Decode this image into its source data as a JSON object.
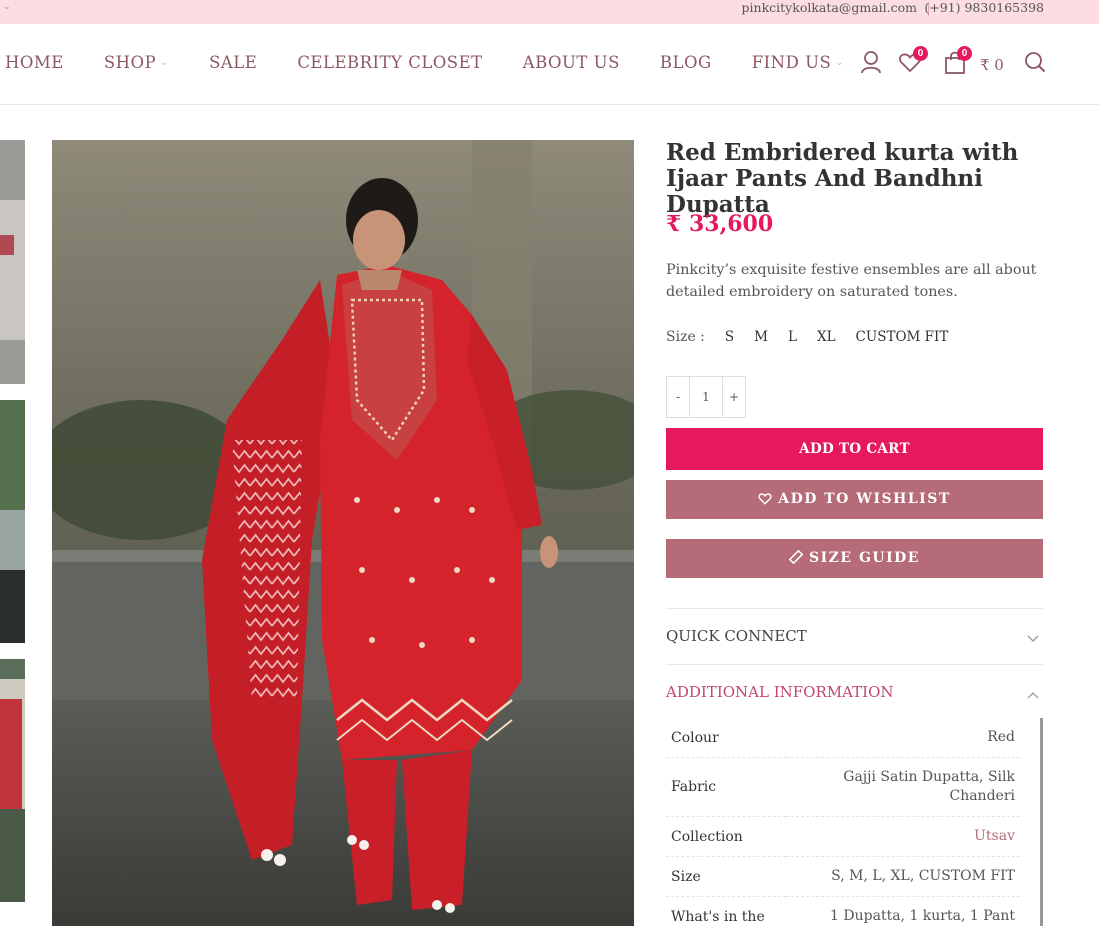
{
  "topbar": {
    "email": "pinkcitykolkata@gmail.com",
    "phone": "(+91) 9830165398"
  },
  "nav": {
    "items": [
      {
        "label": "HOME",
        "has_dropdown": false
      },
      {
        "label": "SHOP",
        "has_dropdown": true
      },
      {
        "label": "SALE",
        "has_dropdown": false
      },
      {
        "label": "CELEBRITY CLOSET",
        "has_dropdown": false
      },
      {
        "label": "ABOUT US",
        "has_dropdown": false
      },
      {
        "label": "BLOG",
        "has_dropdown": false
      },
      {
        "label": "FIND US",
        "has_dropdown": true
      }
    ]
  },
  "header_icons": {
    "account": "user-icon",
    "wishlist": "heart-icon",
    "wishlist_count": "0",
    "cart": "shopping-bag-icon",
    "cart_count": "0",
    "cart_total": "₹ 0",
    "search": "search-icon"
  },
  "product": {
    "title": "Red Embridered kurta with Ijaar Pants And Bandhni Dupatta",
    "price": "₹ 33,600",
    "description": "Pinkcity’s exquisite festive ensembles are all about detailed embroidery on saturated tones.",
    "size_label": "Size :",
    "sizes": [
      "S",
      "M",
      "L",
      "XL",
      "CUSTOM FIT"
    ],
    "quantity": "1",
    "qty_minus": "-",
    "qty_plus": "+",
    "add_to_cart": "ADD TO CART",
    "add_to_wishlist": "ADD TO WISHLIST",
    "size_guide": "SIZE GUIDE"
  },
  "accordion": {
    "quick_connect": "QUICK CONNECT",
    "additional_info": "ADDITIONAL INFORMATION"
  },
  "additional_info": {
    "rows": [
      {
        "key": "Colour",
        "value": "Red"
      },
      {
        "key": "Fabric",
        "value": "Gajji Satin Dupatta, Silk Chanderi"
      },
      {
        "key": "Collection",
        "value": "Utsav"
      },
      {
        "key": "Size",
        "value": "S, M, L, XL, CUSTOM FIT"
      },
      {
        "key": "What's in the",
        "value": "1 Dupatta, 1 kurta, 1 Pant"
      }
    ]
  },
  "colors": {
    "accent": "#e5195b",
    "mauve": "#b56b78",
    "nav_text": "#8d5762",
    "topbar_bg": "#fcdde3"
  }
}
